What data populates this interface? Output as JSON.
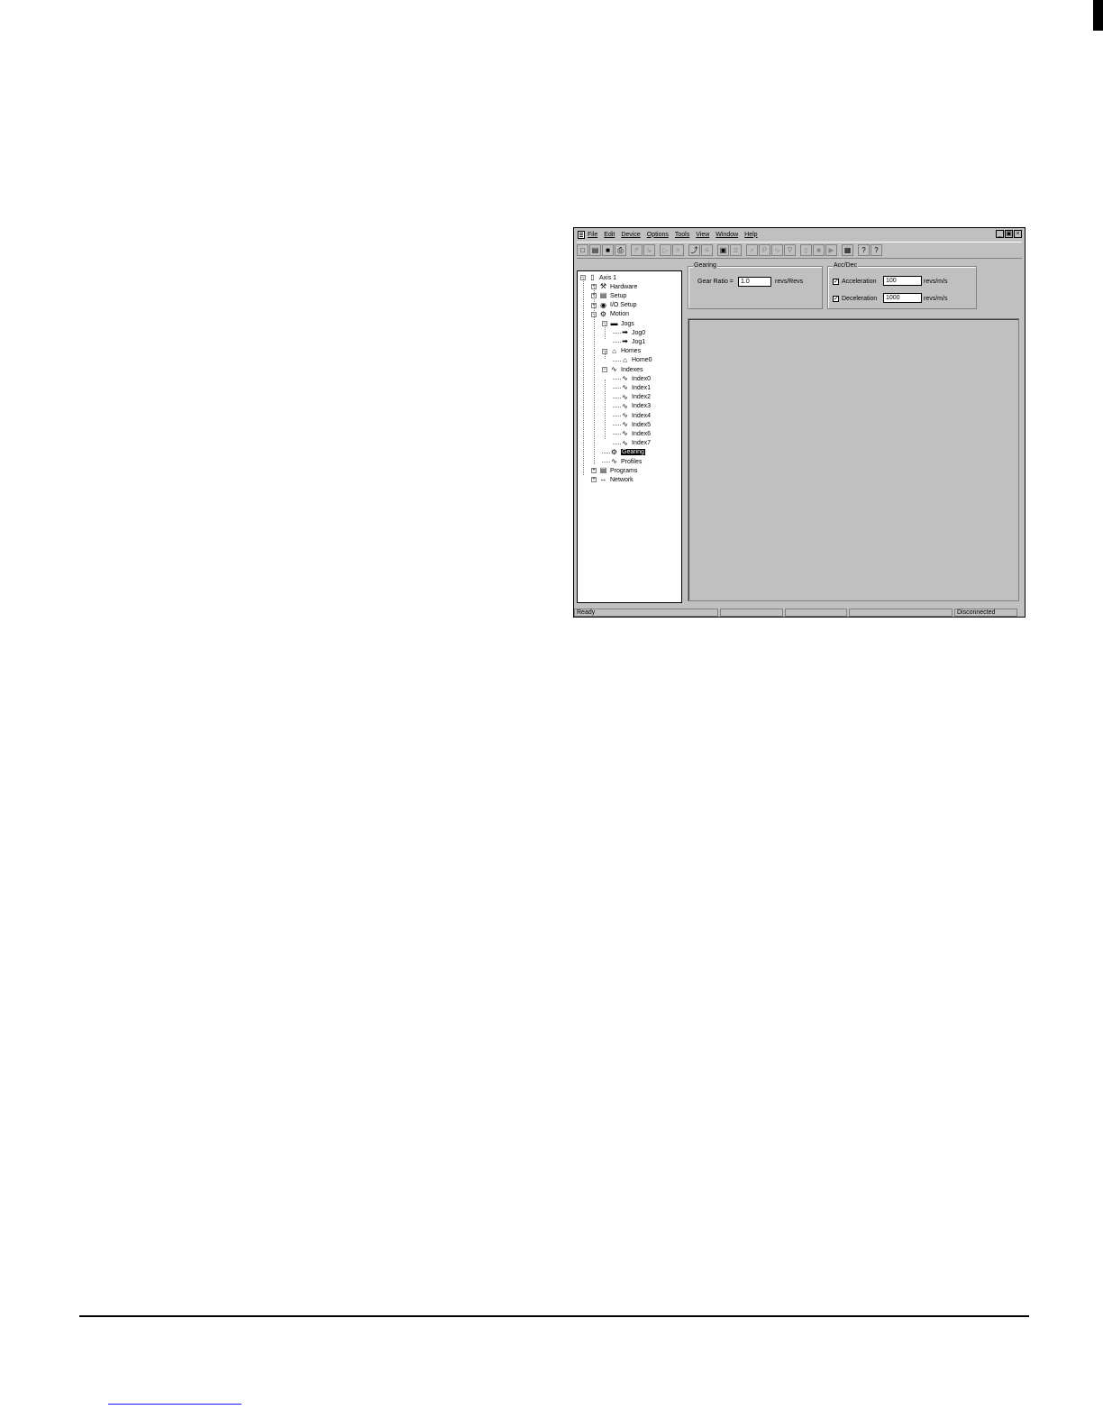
{
  "menu": [
    "File",
    "Edit",
    "Device",
    "Options",
    "Tools",
    "View",
    "Window",
    "Help"
  ],
  "window_controls": [
    "_",
    "▣",
    "×"
  ],
  "toolbar": [
    {
      "name": "new",
      "glyph": "□"
    },
    {
      "name": "open",
      "glyph": "▤"
    },
    {
      "name": "save",
      "glyph": "■"
    },
    {
      "name": "print",
      "glyph": "⎙"
    },
    {
      "name": "upload",
      "glyph": "↱",
      "disabled": true
    },
    {
      "name": "download",
      "glyph": "↳",
      "disabled": true
    },
    {
      "name": "run",
      "glyph": "▷",
      "disabled": true
    },
    {
      "name": "stop",
      "glyph": "×",
      "disabled": true
    },
    {
      "name": "jog",
      "glyph": "⤴"
    },
    {
      "name": "limit",
      "glyph": "≡",
      "disabled": true
    },
    {
      "name": "watch",
      "glyph": "▣"
    },
    {
      "name": "params",
      "glyph": "≣",
      "disabled": true
    },
    {
      "name": "zoom",
      "glyph": "⌕",
      "disabled": true
    },
    {
      "name": "program",
      "glyph": "P",
      "disabled": true
    },
    {
      "name": "profile",
      "glyph": "∿",
      "disabled": true
    },
    {
      "name": "scope",
      "glyph": "∇",
      "disabled": true
    },
    {
      "name": "device",
      "glyph": "▯",
      "disabled": true
    },
    {
      "name": "block",
      "glyph": "■",
      "disabled": true
    },
    {
      "name": "next",
      "glyph": "▶",
      "disabled": true
    },
    {
      "name": "view",
      "glyph": "▦"
    },
    {
      "name": "help",
      "glyph": "?"
    },
    {
      "name": "context-help",
      "glyph": "?"
    }
  ],
  "tree": [
    {
      "label": "Axis 1",
      "depth": 0,
      "expander": "−",
      "icon": "▯"
    },
    {
      "label": "Hardware",
      "depth": 1,
      "expander": "+",
      "icon": "⚒"
    },
    {
      "label": "Setup",
      "depth": 1,
      "expander": "+",
      "icon": "▤"
    },
    {
      "label": "I/O Setup",
      "depth": 1,
      "expander": "+",
      "icon": "◉"
    },
    {
      "label": "Motion",
      "depth": 1,
      "expander": "−",
      "icon": "⚙"
    },
    {
      "label": "Jogs",
      "depth": 2,
      "expander": "−",
      "icon": "▬"
    },
    {
      "label": "Jog0",
      "depth": 3,
      "icon": "➡"
    },
    {
      "label": "Jog1",
      "depth": 3,
      "icon": "➡"
    },
    {
      "label": "Homes",
      "depth": 2,
      "expander": "−",
      "icon": "⌂"
    },
    {
      "label": "Home0",
      "depth": 3,
      "icon": "⌂"
    },
    {
      "label": "Indexes",
      "depth": 2,
      "expander": "−",
      "icon": "∿"
    },
    {
      "label": "Index0",
      "depth": 3,
      "icon": "∿"
    },
    {
      "label": "Index1",
      "depth": 3,
      "icon": "∿"
    },
    {
      "label": "Index2",
      "depth": 3,
      "icon": "∿"
    },
    {
      "label": "Index3",
      "depth": 3,
      "icon": "∿"
    },
    {
      "label": "Index4",
      "depth": 3,
      "icon": "∿"
    },
    {
      "label": "Index5",
      "depth": 3,
      "icon": "∿"
    },
    {
      "label": "Index6",
      "depth": 3,
      "icon": "∿"
    },
    {
      "label": "Index7",
      "depth": 3,
      "icon": "∿"
    },
    {
      "label": "Gearing",
      "depth": 2,
      "icon": "⚙",
      "selected": true
    },
    {
      "label": "Profiles",
      "depth": 2,
      "icon": "∿"
    },
    {
      "label": "Programs",
      "depth": 1,
      "expander": "+",
      "icon": "▤"
    },
    {
      "label": "Network",
      "depth": 1,
      "expander": "+",
      "icon": "↔"
    }
  ],
  "gearing": {
    "title": "Gearing",
    "ratio_label": "Gear Ratio =",
    "ratio_value": "1.0",
    "ratio_units": "revs/Revs"
  },
  "accdec": {
    "title": "Acc/Dec",
    "acceleration": {
      "label": "Acceleration",
      "value": "100",
      "units": "revs/m/s",
      "checked": true
    },
    "deceleration": {
      "label": "Deceleration",
      "value": "1000",
      "units": "revs/m/s",
      "checked": true
    }
  },
  "status": {
    "left": "Ready",
    "right": "Disconnected"
  }
}
